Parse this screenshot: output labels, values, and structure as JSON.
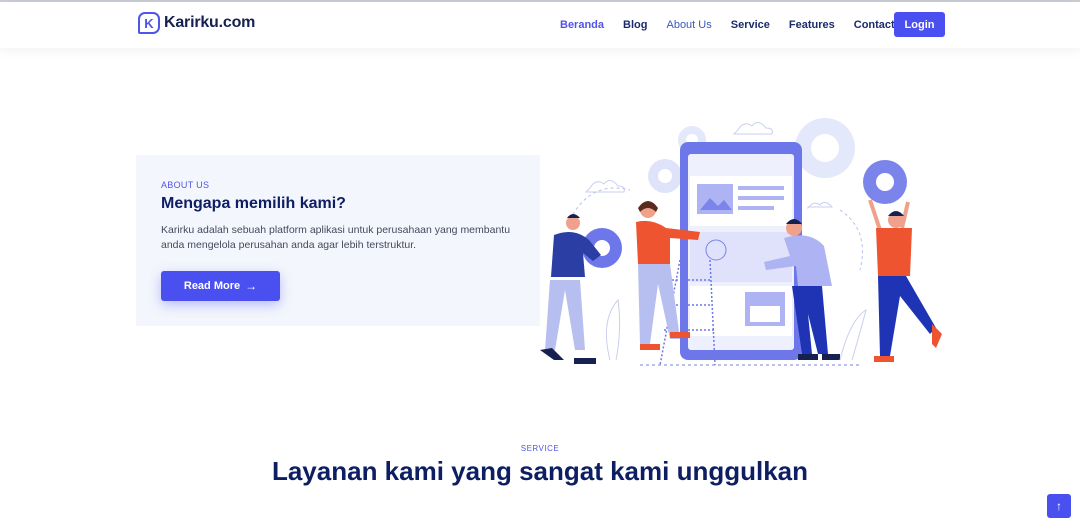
{
  "brand": {
    "name": "Karirku.com",
    "logo_letter": "K",
    "accent": "#4a4ff0"
  },
  "nav": {
    "items": [
      {
        "label": "Beranda"
      },
      {
        "label": "Blog"
      },
      {
        "label": "About Us"
      },
      {
        "label": "Service"
      },
      {
        "label": "Features"
      },
      {
        "label": "Contact"
      }
    ],
    "login_label": "Login"
  },
  "about": {
    "tag": "ABOUT US",
    "title": "Mengapa memilih kami?",
    "description": "Karirku adalah sebuah platform aplikasi untuk perusahaan yang membantu anda mengelola perusahan anda agar lebih terstruktur.",
    "button_label": "Read More",
    "button_icon": "arrow-right-icon",
    "illustration": "team-building-app-illustration"
  },
  "service": {
    "tag": "SERVICE",
    "title": "Layanan kami yang sangat kami unggulkan"
  },
  "scroll_top": {
    "icon": "arrow-up-icon",
    "glyph": "↑"
  }
}
